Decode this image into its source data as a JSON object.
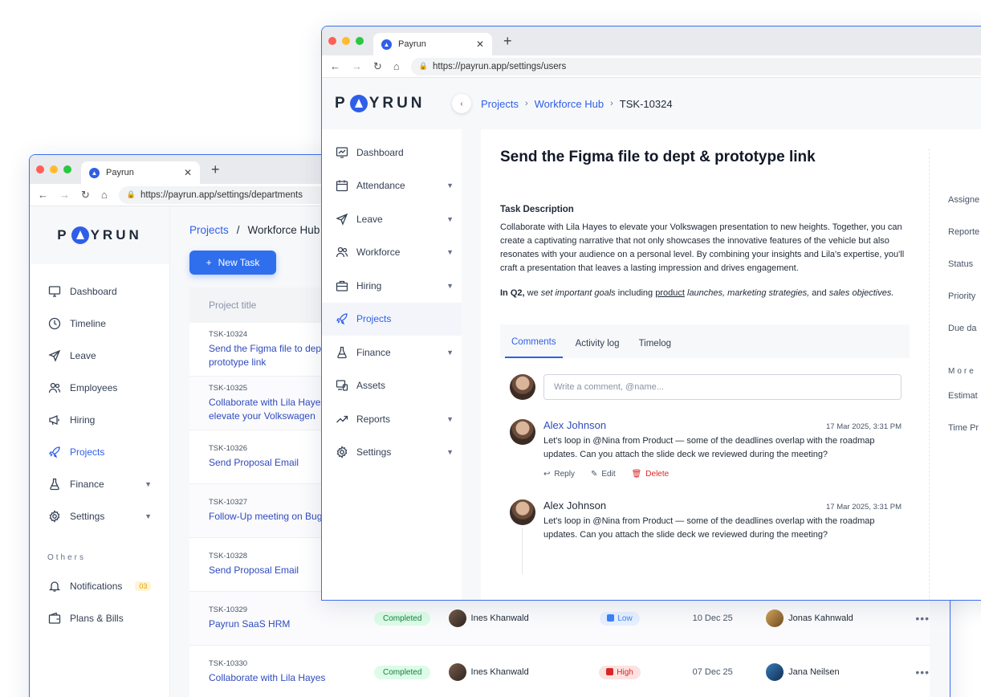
{
  "back_window": {
    "tab_title": "Payrun",
    "url": "https://payrun.app/settings/departments",
    "logo": "PAYRUN",
    "nav": [
      {
        "label": "Dashboard",
        "icon": "monitor-icon",
        "chevron": false,
        "active": false
      },
      {
        "label": "Timeline",
        "icon": "clock-icon",
        "chevron": false,
        "active": false
      },
      {
        "label": "Leave",
        "icon": "plane-icon",
        "chevron": false,
        "active": false
      },
      {
        "label": "Employees",
        "icon": "users-icon",
        "chevron": false,
        "active": false
      },
      {
        "label": "Hiring",
        "icon": "megaphone-icon",
        "chevron": false,
        "active": false
      },
      {
        "label": "Projects",
        "icon": "rocket-icon",
        "chevron": false,
        "active": true
      },
      {
        "label": "Finance",
        "icon": "flask-icon",
        "chevron": true,
        "active": false
      },
      {
        "label": "Settings",
        "icon": "gear-icon",
        "chevron": true,
        "active": false
      }
    ],
    "others_label": "Others",
    "others": [
      {
        "label": "Notifications",
        "icon": "bell-icon",
        "badge": "03"
      },
      {
        "label": "Plans & Bills",
        "icon": "wallet-icon",
        "badge": ""
      }
    ],
    "breadcrumb": {
      "first": "Projects",
      "sep": "/",
      "second": "Workforce Hub"
    },
    "new_task_label": "New Task",
    "table_header": "Project title",
    "rows": [
      {
        "id": "TSK-10324",
        "title": "Send the Figma file to dept & prototype link"
      },
      {
        "id": "TSK-10325",
        "title": "Collaborate with Lila Hayes to elevate your Volkswagen"
      },
      {
        "id": "TSK-10326",
        "title": "Send Proposal Email"
      },
      {
        "id": "TSK-10327",
        "title": "Follow-Up meeting on Bug fixes"
      },
      {
        "id": "TSK-10328",
        "title": "Send Proposal Email"
      },
      {
        "id": "TSK-10329",
        "title": "Payrun SaaS HRM",
        "status": "Completed",
        "assignee": "Ines Khanwald",
        "priority": "Low",
        "due": "10 Dec 25",
        "reporter": "Jonas Kahnwald"
      },
      {
        "id": "TSK-10330",
        "title": "Collaborate with Lila Hayes",
        "status": "Completed",
        "assignee": "Ines Khanwald",
        "priority": "High",
        "due": "07 Dec 25",
        "reporter": "Jana Neilsen"
      }
    ]
  },
  "front_window": {
    "tab_title": "Payrun",
    "url": "https://payrun.app/settings/users",
    "logo": "PAYRUN",
    "nav": [
      {
        "label": "Dashboard",
        "icon": "chart-icon",
        "chevron": false,
        "active": false
      },
      {
        "label": "Attendance",
        "icon": "calendar-icon",
        "chevron": true,
        "active": false
      },
      {
        "label": "Leave",
        "icon": "plane-icon",
        "chevron": true,
        "active": false
      },
      {
        "label": "Workforce",
        "icon": "users-icon",
        "chevron": true,
        "active": false
      },
      {
        "label": "Hiring",
        "icon": "briefcase-icon",
        "chevron": true,
        "active": false
      },
      {
        "label": "Projects",
        "icon": "rocket-icon",
        "chevron": false,
        "active": true
      },
      {
        "label": "Finance",
        "icon": "flask-icon",
        "chevron": true,
        "active": false
      },
      {
        "label": "Assets",
        "icon": "devices-icon",
        "chevron": false,
        "active": false
      },
      {
        "label": "Reports",
        "icon": "trend-icon",
        "chevron": true,
        "active": false
      },
      {
        "label": "Settings",
        "icon": "gear-icon",
        "chevron": true,
        "active": false
      }
    ],
    "breadcrumb": [
      "Projects",
      "Workforce Hub",
      "TSK-10324"
    ],
    "task_title": "Send the Figma file to dept & prototype link",
    "description_label": "Task Description",
    "description": "Collaborate with Lila Hayes to elevate your Volkswagen presentation to new heights. Together, you can create a captivating narrative that not only showcases the innovative features of the vehicle but also resonates with your audience on a personal level. By combining your insights and Lila's expertise, you'll craft a presentation that leaves a lasting impression and drives engagement.",
    "description2": {
      "lead": "In Q2,",
      "p1": " we ",
      "i1": "set important goals",
      "p2": " including ",
      "u1": "product",
      "i2": " launches, marketing strategies,",
      "p3": " and ",
      "i3": "sales objectives."
    },
    "tabs": [
      "Comments",
      "Activity log",
      "Timelog"
    ],
    "comment_placeholder": "Write a comment, @name...",
    "comments": [
      {
        "name": "Alex Johnson",
        "time": "17 Mar 2025, 3:31 PM",
        "text": "Let's loop in @Nina from Product — some of the deadlines overlap with the roadmap updates. Can you attach the slide deck we reviewed during the meeting?"
      },
      {
        "name": "Alex Johnson",
        "time": "17 Mar 2025, 3:31 PM",
        "text": "Let's loop in @Nina from Product — some of the deadlines overlap with the roadmap updates. Can you attach the slide deck we reviewed during the meeting?"
      }
    ],
    "actions": {
      "reply": "Reply",
      "edit": "Edit",
      "delete": "Delete"
    },
    "right_labels": [
      "Assigne",
      "Reporte",
      "Status",
      "Priority",
      "Due da"
    ],
    "more_label": "More",
    "more_labels": [
      "Estimat",
      "Time Pr"
    ]
  }
}
